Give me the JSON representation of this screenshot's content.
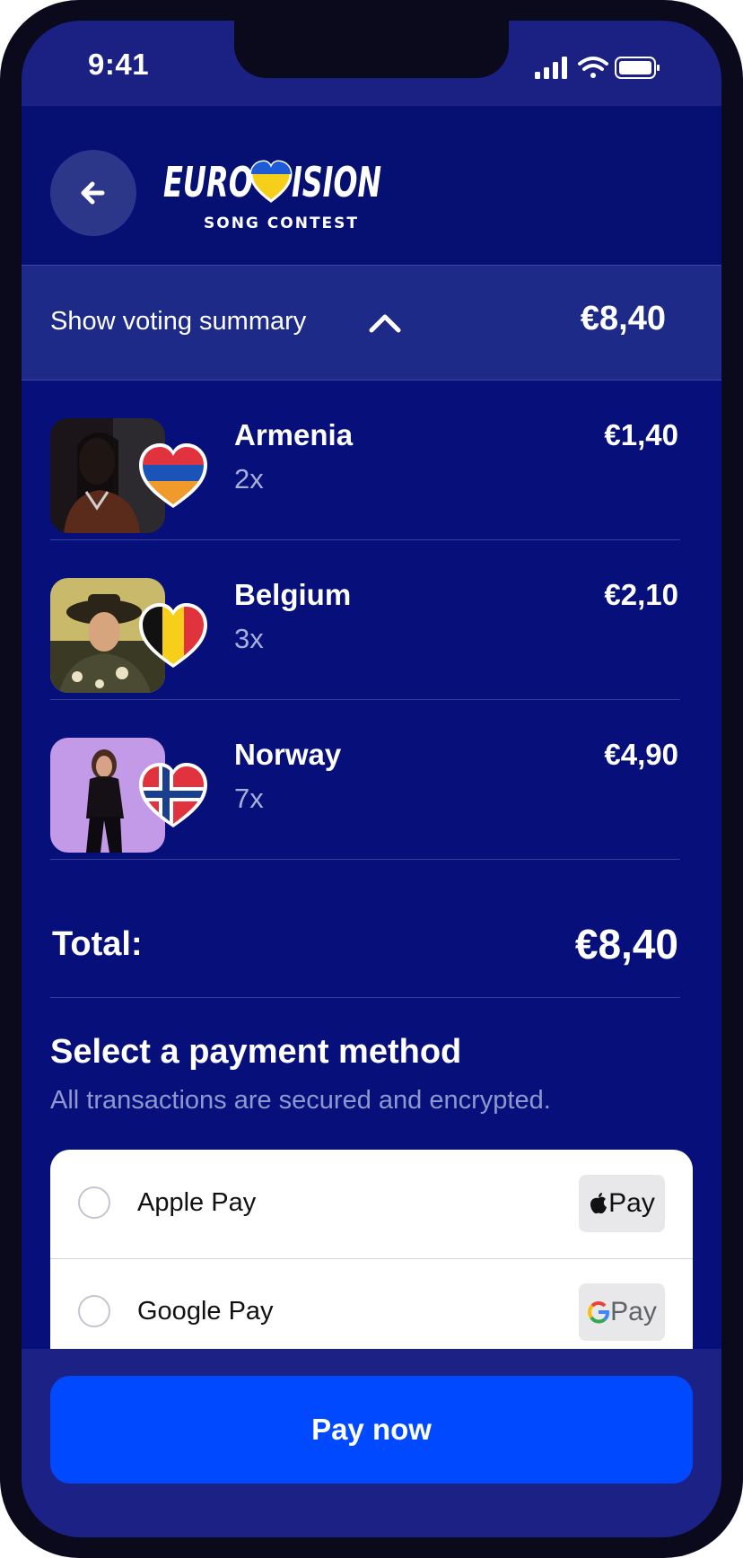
{
  "status": {
    "time": "9:41"
  },
  "header": {
    "logo_title": "EUROVISION",
    "logo_subtitle": "SONG CONTEST"
  },
  "summary": {
    "label": "Show voting summary",
    "total": "€8,40"
  },
  "votes": [
    {
      "country": "Armenia",
      "count": "2x",
      "price": "€1,40"
    },
    {
      "country": "Belgium",
      "count": "3x",
      "price": "€2,10"
    },
    {
      "country": "Norway",
      "count": "7x",
      "price": "€4,90"
    }
  ],
  "total": {
    "label": "Total:",
    "value": "€8,40"
  },
  "payment": {
    "title": "Select a payment method",
    "subtitle": "All transactions are secured and encrypted.",
    "methods": [
      {
        "label": "Apple Pay",
        "badge": "Pay",
        "icon": "apple-icon"
      },
      {
        "label": "Google Pay",
        "badge": "Pay",
        "icon": "google-icon"
      }
    ]
  },
  "footer": {
    "pay_label": "Pay now"
  },
  "colors": {
    "background": "#07107a",
    "header": "#060f72",
    "summary_bar": "#1e2a87",
    "accent": "#0049ff"
  }
}
